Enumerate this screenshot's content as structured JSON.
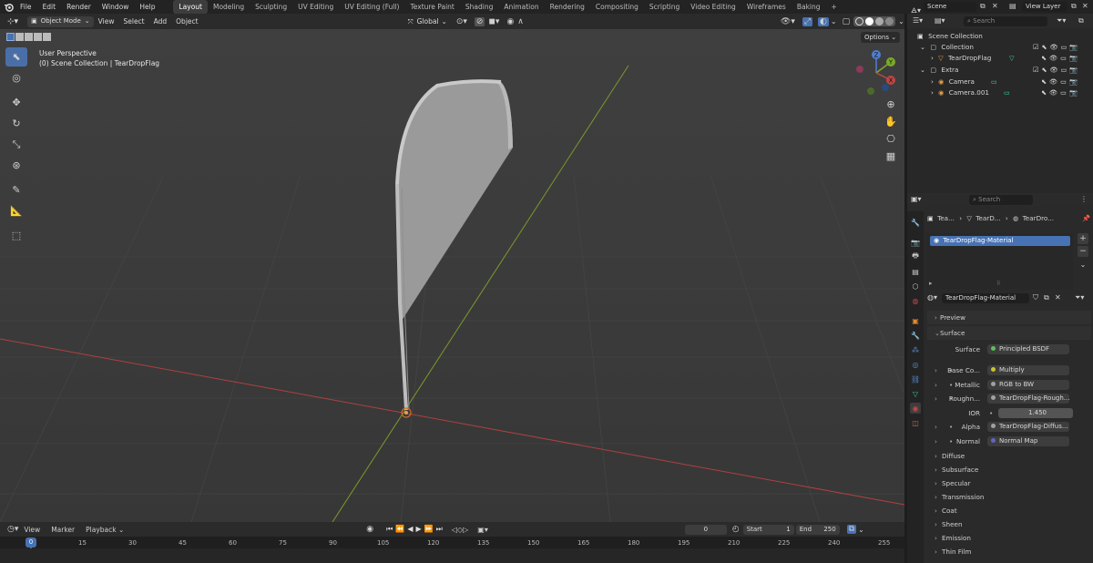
{
  "menus": [
    "File",
    "Edit",
    "Render",
    "Window",
    "Help"
  ],
  "workspaces": [
    "Layout",
    "Modeling",
    "Sculpting",
    "UV Editing",
    "UV Editing (Full)",
    "Texture Paint",
    "Shading",
    "Animation",
    "Rendering",
    "Compositing",
    "Scripting",
    "Video Editing",
    "Wireframes",
    "Baking"
  ],
  "active_workspace": "Layout",
  "scene_name": "Scene",
  "view_layer": "View Layer",
  "viewport": {
    "mode": "Object Mode",
    "menus": [
      "View",
      "Select",
      "Add",
      "Object"
    ],
    "orientation": "Global",
    "options_label": "Options",
    "overlay_line1": "User Perspective",
    "overlay_line2": "(0) Scene Collection | TearDropFlag",
    "gizmo": {
      "z": "Z",
      "y": "Y",
      "x": "X"
    }
  },
  "outliner": {
    "search_placeholder": "Search",
    "rows": [
      {
        "label": "Scene Collection"
      },
      {
        "label": "Collection"
      },
      {
        "label": "TearDropFlag"
      },
      {
        "label": "Extra"
      },
      {
        "label": "Camera"
      },
      {
        "label": "Camera.001"
      }
    ]
  },
  "properties": {
    "search_placeholder": "Search",
    "breadcrumb": [
      "Tea...",
      "TearD...",
      "TearDro..."
    ],
    "slot_name": "TearDropFlag-Material",
    "material_name": "TearDropFlag-Material",
    "sections": {
      "preview": "Preview",
      "surface": "Surface"
    },
    "surface_rows": [
      {
        "label": "Surface",
        "value": "Principled BSDF",
        "color": "#5fbf5f"
      },
      {
        "label": "Base Co...",
        "value": "Multiply",
        "color": "#c7c729"
      },
      {
        "label": "Metallic",
        "value": "RGB to BW",
        "color": "#a1a1a1"
      },
      {
        "label": "Roughn...",
        "value": "TearDropFlag-Rough...",
        "color": "#a1a1a1"
      },
      {
        "label": "IOR",
        "value": "1.450",
        "color": "#a1a1a1"
      },
      {
        "label": "Alpha",
        "value": "TearDropFlag-Diffus...",
        "color": "#a1a1a1"
      },
      {
        "label": "Normal",
        "value": "Normal Map",
        "color": "#6363c7"
      }
    ],
    "subpanels": [
      "Diffuse",
      "Subsurface",
      "Specular",
      "Transmission",
      "Coat",
      "Sheen",
      "Emission",
      "Thin Film"
    ]
  },
  "timeline": {
    "menus": [
      "View",
      "Marker",
      "Playback"
    ],
    "current_frame": "0",
    "start_label": "Start",
    "start": "1",
    "end_label": "End",
    "end": "250",
    "playhead": "0",
    "ticks": [
      "15",
      "30",
      "45",
      "60",
      "75",
      "90",
      "105",
      "120",
      "135",
      "150",
      "165",
      "180",
      "195",
      "210",
      "225",
      "240",
      "255"
    ]
  },
  "colors": {
    "accent": "#4772b3",
    "x_axis": "#b04040",
    "y_axis": "#7a9a2a"
  }
}
